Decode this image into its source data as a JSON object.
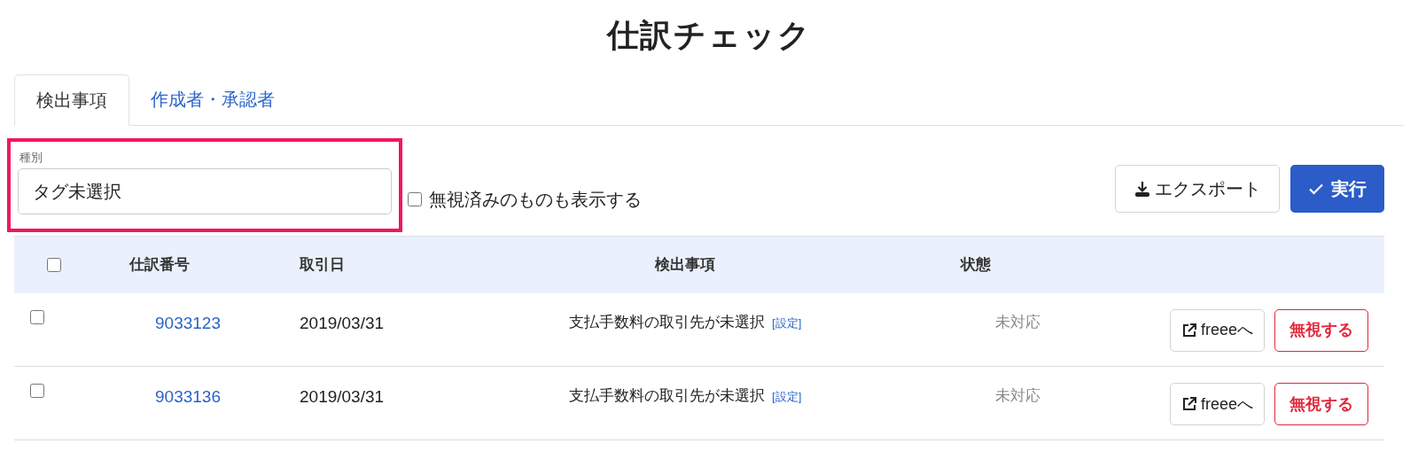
{
  "title": "仕訳チェック",
  "tabs": [
    {
      "label": "検出事項",
      "selected": true
    },
    {
      "label": "作成者・承認者",
      "selected": false
    }
  ],
  "filter": {
    "label": "種別",
    "value": "タグ未選択",
    "highlighted": true
  },
  "show_ignored": {
    "label": "無視済みのものも表示する",
    "checked": false
  },
  "actions": [
    {
      "kind": "export",
      "label": "エクスポート"
    },
    {
      "kind": "run",
      "label": "実行"
    }
  ],
  "table": {
    "select_all": {
      "checked": false
    },
    "columns": [
      "仕訳番号",
      "取引日",
      "検出事項",
      "状態"
    ],
    "rows": [
      {
        "checked": false,
        "number": "9033123",
        "date": "2019/03/31",
        "issue": "支払手数料の取引先が未選択",
        "issue_link": "[設定]",
        "status": "未対応",
        "open_button": "freeeへ",
        "ignore_button": "無視する"
      },
      {
        "checked": false,
        "number": "9033136",
        "date": "2019/03/31",
        "issue": "支払手数料の取引先が未選択",
        "issue_link": "[設定]",
        "status": "未対応",
        "open_button": "freeeへ",
        "ignore_button": "無視する"
      }
    ]
  }
}
